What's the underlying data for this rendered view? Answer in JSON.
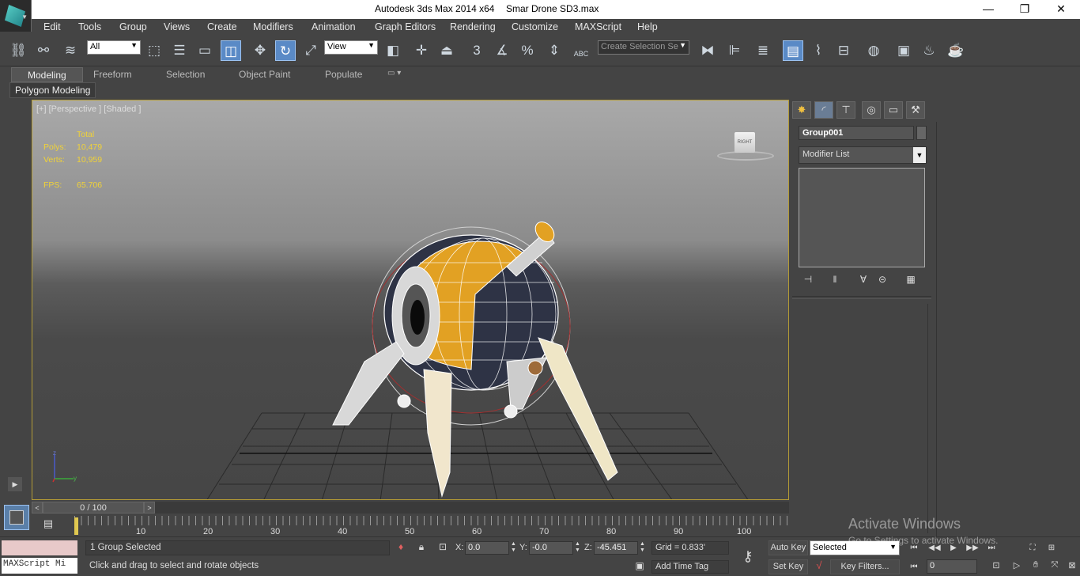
{
  "window": {
    "title": "Autodesk 3ds Max  2014 x64",
    "file": "Smar Drone SD3.max",
    "controls": {
      "minimize": "—",
      "restore": "❐",
      "close": "✕"
    }
  },
  "menu": [
    "Edit",
    "Tools",
    "Group",
    "Views",
    "Create",
    "Modifiers",
    "Animation",
    "Graph Editors",
    "Rendering",
    "Customize",
    "MAXScript",
    "Help"
  ],
  "toolbar": {
    "selection_filter": "All",
    "reference_coord": "View",
    "named_selection_placeholder": "Create Selection Se",
    "snap_labels": {
      "snap3": "3",
      "percent": "%"
    },
    "abc_label": "ABC"
  },
  "ribbon": {
    "tabs": [
      "Modeling",
      "Freeform",
      "Selection",
      "Object Paint",
      "Populate"
    ],
    "active_tab": "Modeling",
    "panel_label": "Polygon Modeling"
  },
  "viewport": {
    "label": "[+] [Perspective ] [Shaded ]",
    "stats": {
      "header": "Total",
      "polys_label": "Polys:",
      "polys_value": "10,479",
      "verts_label": "Verts:",
      "verts_value": "10,959",
      "fps_label": "FPS:",
      "fps_value": "65.706"
    },
    "viewcube_label": "RIGHT",
    "axis_labels": {
      "z": "z",
      "y": "y"
    }
  },
  "command_panel": {
    "object_name": "Group001",
    "modifier_list": "Modifier List"
  },
  "time_slider": {
    "frame_display": "0 / 100",
    "ticks": [
      "10",
      "20",
      "30",
      "40",
      "50",
      "60",
      "70",
      "80",
      "90",
      "100"
    ]
  },
  "status": {
    "selection": "1 Group Selected",
    "prompt": "Click and drag to select and rotate objects",
    "maxscript": "MAXScript Mi",
    "x_label": "X:",
    "x_value": "0.0",
    "y_label": "Y:",
    "y_value": "-0.0",
    "z_label": "Z:",
    "z_value": "-45.451",
    "grid": "Grid = 0.833'",
    "add_time_tag": "Add Time Tag",
    "auto_key": "Auto Key",
    "set_key": "Set Key",
    "selected_dropdown": "Selected",
    "key_filters": "Key Filters...",
    "current_frame": "0"
  },
  "watermark": {
    "line1": "Activate Windows",
    "line2": "Go to Settings to activate Windows."
  },
  "colors": {
    "viewport_border": "#b39b36",
    "stats_text": "#f0d238",
    "active_button": "#5a8ac6"
  }
}
